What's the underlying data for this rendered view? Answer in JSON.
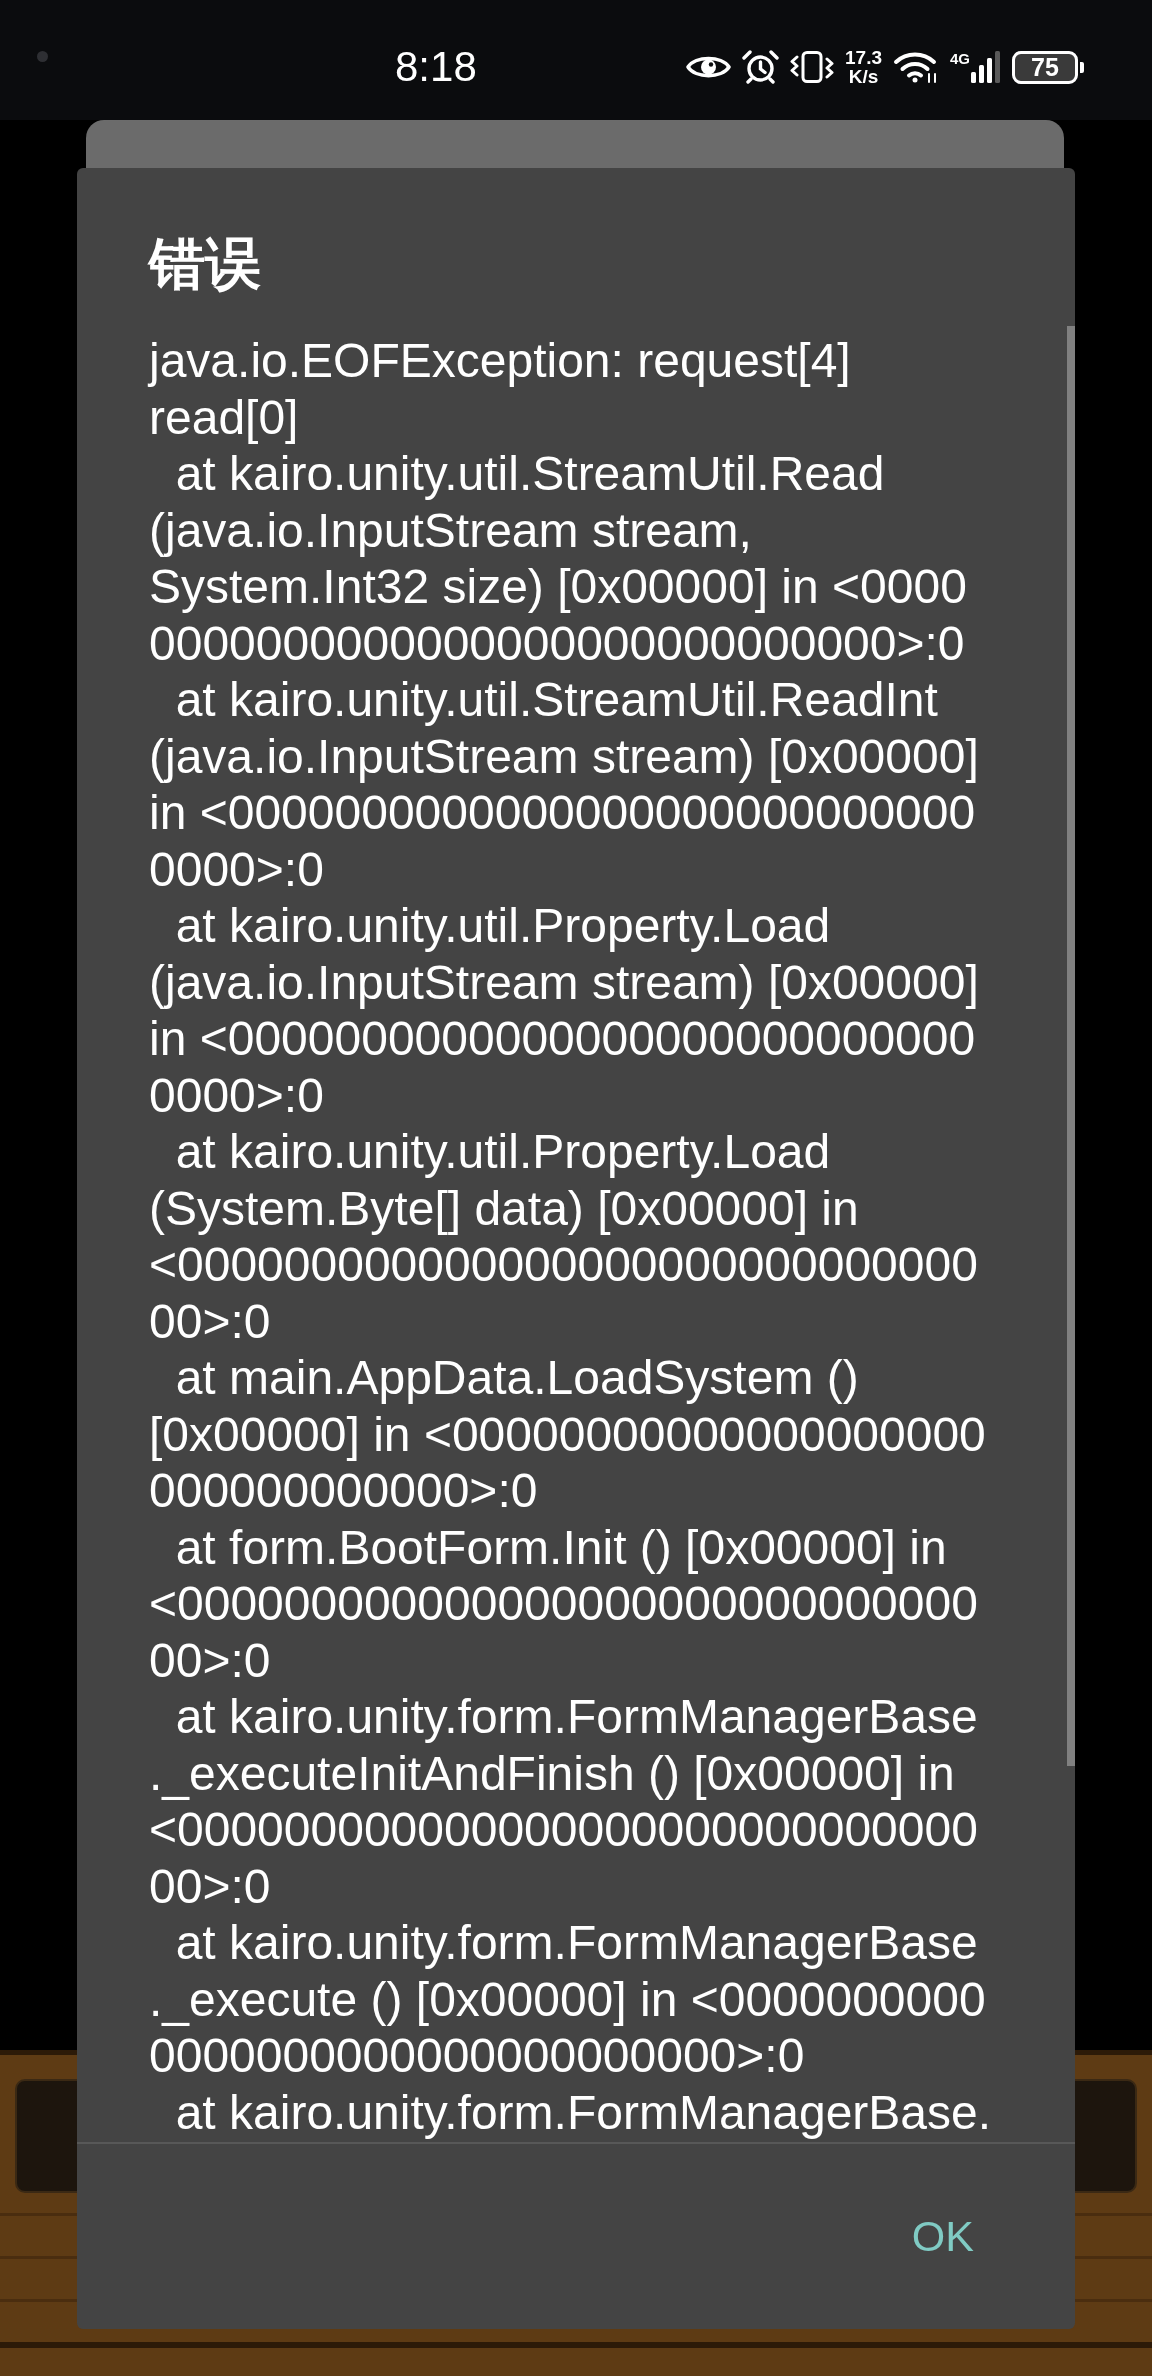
{
  "status_bar": {
    "time": "8:18",
    "network_speed": {
      "value": "17.3",
      "unit": "K/s"
    },
    "network_type": "4G",
    "battery": "75"
  },
  "dialog": {
    "title": "错误",
    "message": "java.io.EOFException: request[4]\nread[0]\n  at kairo.unity.util.StreamUtil.Read\n(java.io.InputStream stream,\nSystem.Int32 size) [0x00000] in <0000\n0000000000000000000000000000>:0\n  at kairo.unity.util.StreamUtil.ReadInt\n(java.io.InputStream stream) [0x00000]\nin <0000000000000000000000000000\n0000>:0\n  at kairo.unity.util.Property.Load\n(java.io.InputStream stream) [0x00000]\nin <0000000000000000000000000000\n0000>:0\n  at kairo.unity.util.Property.Load\n(System.Byte[] data) [0x00000] in\n<000000000000000000000000000000\n00>:0\n  at main.AppData.LoadSystem ()\n[0x00000] in <00000000000000000000\n000000000000>:0\n  at form.BootForm.Init () [0x00000] in\n<000000000000000000000000000000\n00>:0\n  at kairo.unity.form.FormManagerBase\n._executeInitAndFinish () [0x00000] in\n<000000000000000000000000000000\n00>:0\n  at kairo.unity.form.FormManagerBase\n._execute () [0x00000] in <0000000000\n0000000000000000000000>:0\n  at kairo.unity.form.FormManagerBase.",
    "buttons": [
      {
        "label": "OK"
      }
    ]
  }
}
